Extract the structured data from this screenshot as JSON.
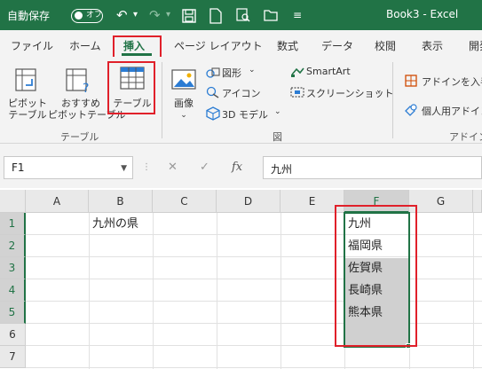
{
  "titlebar": {
    "autosave_label": "自動保存",
    "autosave_state": "オフ",
    "document_title": "Book3 - Excel",
    "bg_color": "#217346"
  },
  "ribbon_tabs": [
    "ファイル",
    "ホーム",
    "挿入",
    "ページ レイアウト",
    "数式",
    "データ",
    "校閲",
    "表示",
    "開発"
  ],
  "active_tab": "挿入",
  "ribbon": {
    "table_group": {
      "pivot_table": "ピボット\nテーブル",
      "recommended_pivot": "おすすめ\nピボットテーブル",
      "table": "テーブル",
      "label": "テーブル"
    },
    "illustrations_group": {
      "image": "画像",
      "shapes": "図形",
      "icons": "アイコン",
      "model3d": "3D モデル",
      "smartart": "SmartArt",
      "screenshot": "スクリーンショット",
      "label": "図"
    },
    "addins_group": {
      "get_addins": "アドインを入手",
      "my_addins": "個人用アドイン",
      "label": "アドイン"
    }
  },
  "formula_bar": {
    "name_box": "F1",
    "fx": "fx",
    "content": "九州"
  },
  "sheet": {
    "columns": [
      "A",
      "B",
      "C",
      "D",
      "E",
      "F",
      "G"
    ],
    "rows": [
      "1",
      "2",
      "3",
      "4",
      "5",
      "6",
      "7"
    ],
    "cells": {
      "B1": "九州の県",
      "F1": "九州",
      "F2": "福岡県",
      "F3": "佐賀県",
      "F4": "長崎県",
      "F5": "熊本県"
    },
    "selected_column": "F",
    "selected_range": "F1:F5"
  },
  "highlight_color": "#e0202a"
}
